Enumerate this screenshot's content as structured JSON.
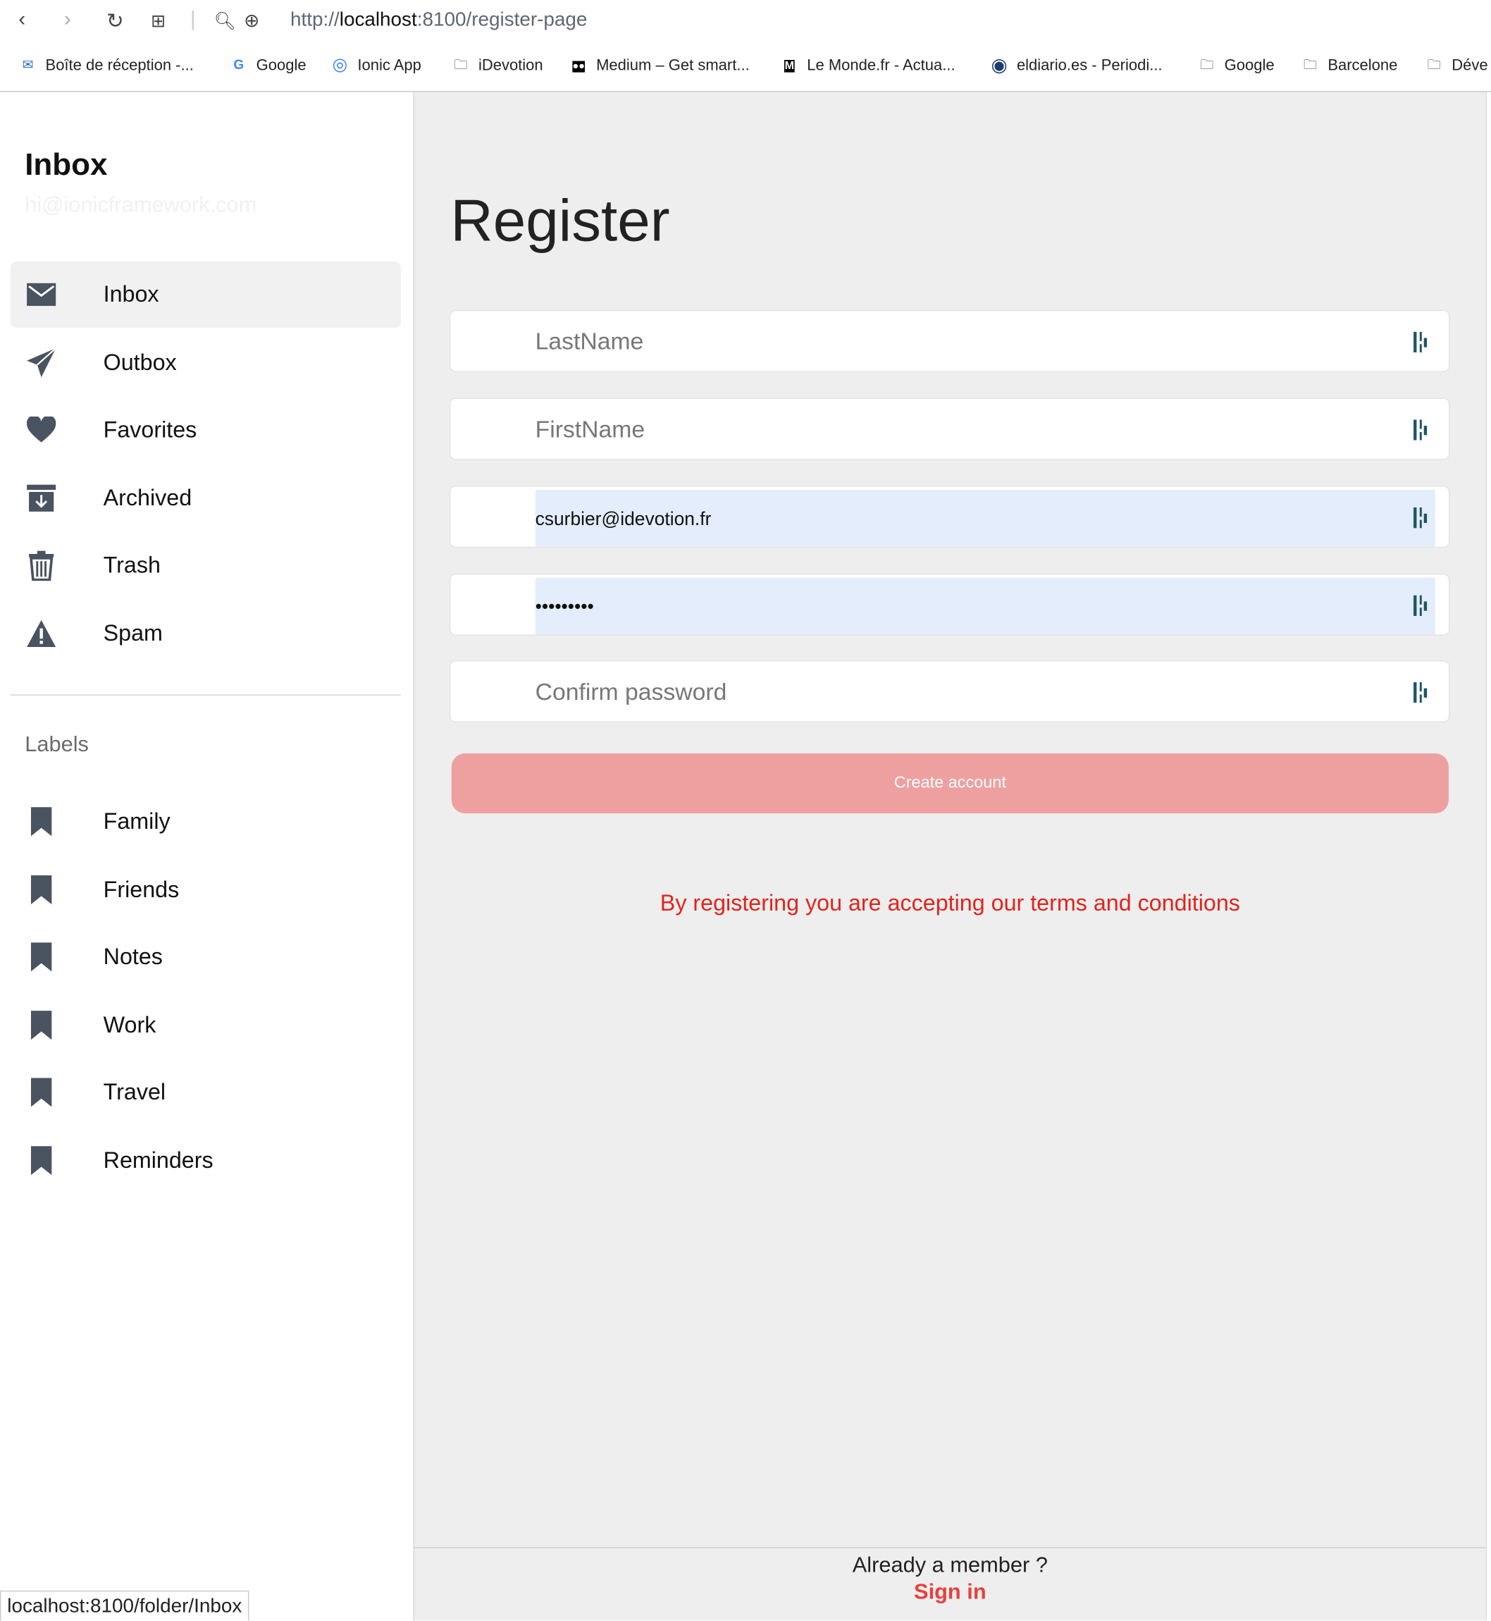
{
  "browser": {
    "url_prefix": "http://",
    "url_host": "localhost",
    "url_rest": ":8100/register-page",
    "bookmarks": [
      {
        "label": "Boîte de réception -...",
        "icon": "mail-icon"
      },
      {
        "label": "Google",
        "icon": "google-icon"
      },
      {
        "label": "Ionic App",
        "icon": "ionic-icon"
      },
      {
        "label": "iDevotion",
        "icon": "folder-icon"
      },
      {
        "label": "Medium – Get smart...",
        "icon": "medium-icon"
      },
      {
        "label": "Le Monde.fr - Actua...",
        "icon": "lemonde-icon"
      },
      {
        "label": "eldiario.es - Periodi...",
        "icon": "eldiario-icon"
      },
      {
        "label": "Google",
        "icon": "folder-icon"
      },
      {
        "label": "Barcelone",
        "icon": "folder-icon"
      },
      {
        "label": "Déve",
        "icon": "folder-icon"
      }
    ]
  },
  "sidebar": {
    "title": "Inbox",
    "email": "hi@ionicframework.com",
    "items": [
      {
        "label": "Inbox",
        "icon": "mail-icon",
        "active": true
      },
      {
        "label": "Outbox",
        "icon": "paper-plane-icon"
      },
      {
        "label": "Favorites",
        "icon": "heart-icon"
      },
      {
        "label": "Archived",
        "icon": "archive-icon"
      },
      {
        "label": "Trash",
        "icon": "trash-icon"
      },
      {
        "label": "Spam",
        "icon": "warning-icon"
      }
    ],
    "labels_heading": "Labels",
    "labels": [
      {
        "label": "Family",
        "icon": "bookmark-icon"
      },
      {
        "label": "Friends",
        "icon": "bookmark-icon"
      },
      {
        "label": "Notes",
        "icon": "bookmark-icon"
      },
      {
        "label": "Work",
        "icon": "bookmark-icon"
      },
      {
        "label": "Travel",
        "icon": "bookmark-icon"
      },
      {
        "label": "Reminders",
        "icon": "bookmark-icon"
      }
    ]
  },
  "main": {
    "title": "Register",
    "fields": {
      "lastname_placeholder": "LastName",
      "firstname_placeholder": "FirstName",
      "email_value": "csurbier@idevotion.fr",
      "password_value": "•••••••••",
      "confirm_placeholder": "Confirm password"
    },
    "create_button": "Create account",
    "terms": "By registering you are accepting our terms and conditions",
    "already_member": "Already a member ?",
    "sign_in": "Sign in"
  },
  "status_bar": "localhost:8100/folder/Inbox",
  "colors": {
    "accent": "#e3231c",
    "button": "#eea0a0",
    "autofill": "#e3edfb",
    "background": "#eeeeee"
  }
}
